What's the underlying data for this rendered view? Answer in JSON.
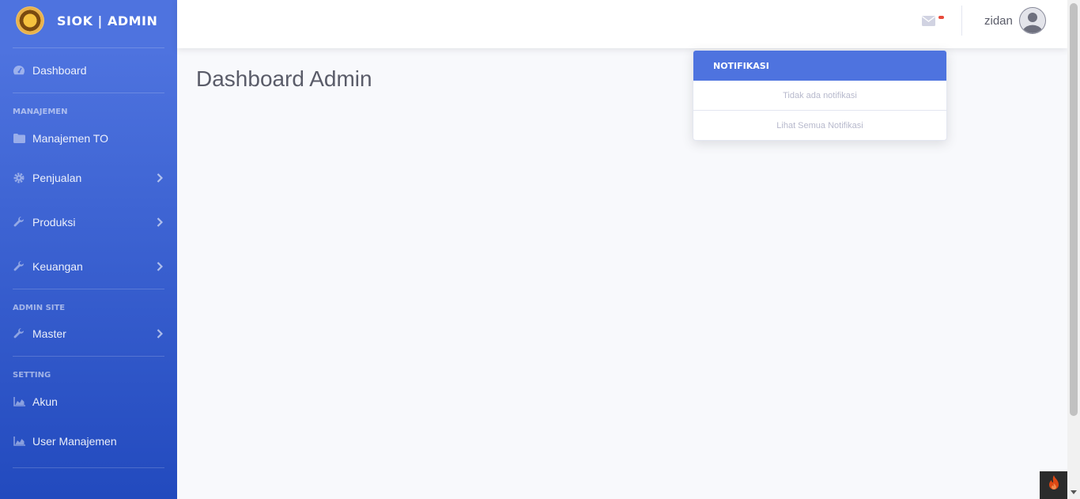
{
  "brand": {
    "title": "SIOK | ADMIN",
    "logo_icon": "company-logo"
  },
  "sidebar": {
    "dashboard": {
      "label": "Dashboard",
      "icon": "tachometer-icon"
    },
    "sections": [
      {
        "heading": "MANAJEMEN"
      },
      {
        "heading": "ADMIN SITE"
      },
      {
        "heading": "SETTING"
      }
    ],
    "items": [
      {
        "label": "Manajemen TO",
        "icon": "folder-icon"
      },
      {
        "label": "Penjualan",
        "icon": "cog-icon"
      },
      {
        "label": "Produksi",
        "icon": "wrench-icon"
      },
      {
        "label": "Keuangan",
        "icon": "wrench-icon"
      },
      {
        "label": "Master",
        "icon": "wrench-icon"
      },
      {
        "label": "Akun",
        "icon": "chart-area-icon"
      },
      {
        "label": "User Manajemen",
        "icon": "chart-area-icon"
      }
    ]
  },
  "topbar": {
    "user_name": "zidan",
    "mail_icon": "envelope-icon",
    "avatar_icon": "user-avatar-icon"
  },
  "main": {
    "page_title": "Dashboard Admin"
  },
  "notifications": {
    "header": "NOTIFIKASI",
    "empty_text": "Tidak ada notifikasi",
    "footer_link": "Lihat Semua Notifikasi"
  },
  "colors": {
    "sidebar_top": "#4e73df",
    "sidebar_bottom": "#224abe",
    "accent": "#4e73df",
    "badge": "#e74a3b"
  }
}
